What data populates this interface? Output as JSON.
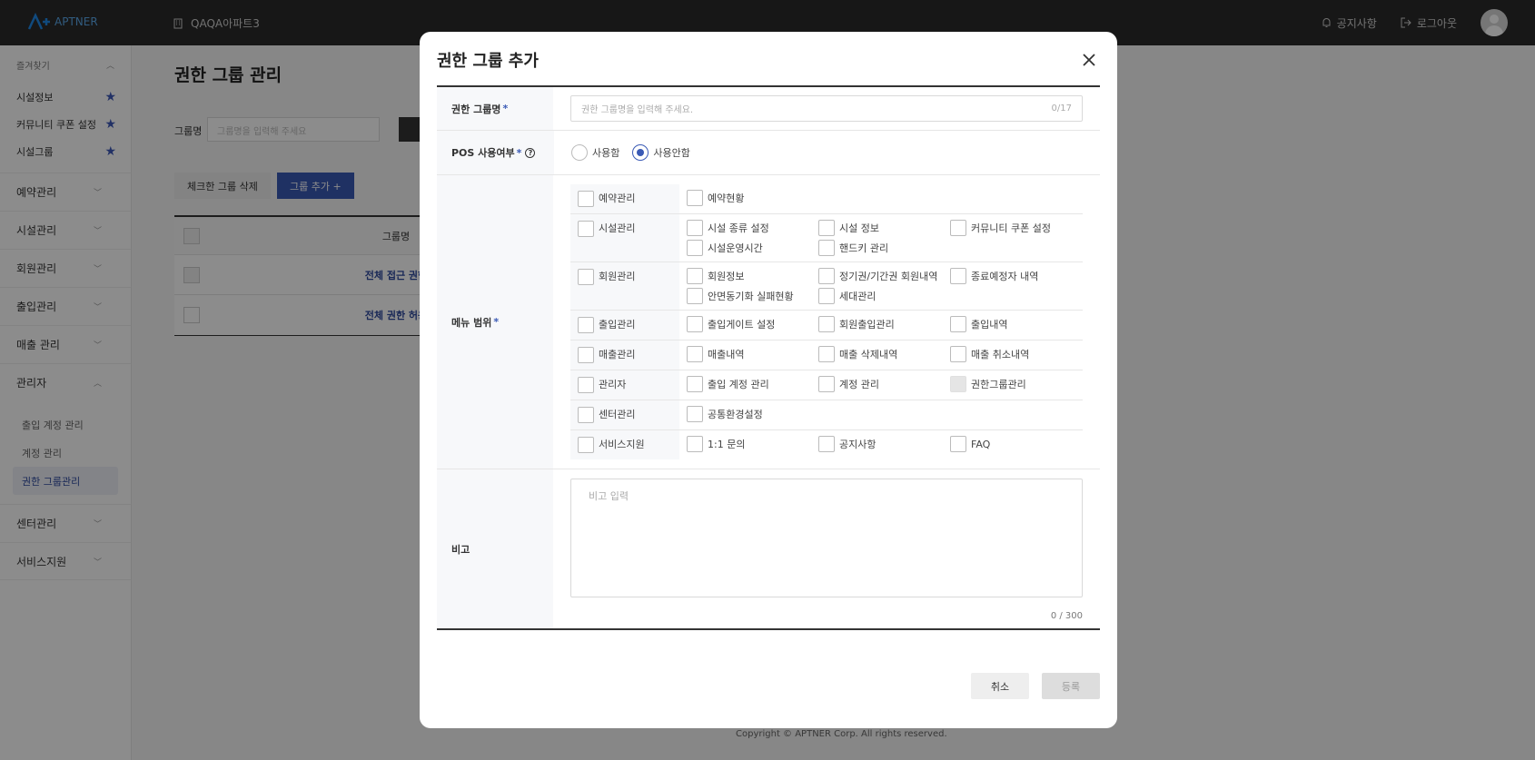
{
  "header": {
    "logo_text": "APTNER",
    "apartment": "QAQA아파트3",
    "notice": "공지사항",
    "logout": "로그아웃"
  },
  "sidebar": {
    "favorites_title": "즐겨찾기",
    "favorites": [
      "시설정보",
      "커뮤니티 쿠폰 설정",
      "시설그룹"
    ],
    "sections": [
      "예약관리",
      "시설관리",
      "회원관리",
      "출입관리",
      "매출 관리",
      "관리자"
    ],
    "admin_items": [
      "출입 계정 관리",
      "계정 관리",
      "권한 그룹관리"
    ],
    "bottom_sections": [
      "센터관리",
      "서비스지원"
    ]
  },
  "page": {
    "title": "권한 그룹 관리",
    "filter_label": "그룹명",
    "filter_placeholder": "그룹명을 입력해 주세요",
    "delete_btn": "체크한 그룹 삭제",
    "add_btn": "그룹 추가  +",
    "table_header": "그룹명",
    "rows": [
      "전체 접근 권한",
      "전체 권한 허용"
    ],
    "footer": "Copyright © APTNER Corp. All rights reserved."
  },
  "modal": {
    "title": "권한 그룹 추가",
    "name_label": "권한 그룹명",
    "name_placeholder": "권한 그룹명을 입력해 주세요.",
    "name_count": "0/17",
    "pos_label": "POS 사용여부",
    "pos_help": "?",
    "pos_options": [
      "사용함",
      "사용안함"
    ],
    "pos_selected": "사용안함",
    "menu_label": "메뉴 범위",
    "menu": [
      {
        "category": "예약관리",
        "items": [
          "예약현황"
        ]
      },
      {
        "category": "시설관리",
        "items": [
          "시설 종류 설정",
          "시설 정보",
          "커뮤니티 쿠폰 설정",
          "시설운영시간",
          "핸드키 관리"
        ]
      },
      {
        "category": "회원관리",
        "items": [
          "회원정보",
          "정기권/기간권 회원내역",
          "종료예정자 내역",
          "안면동기화 실패현황",
          "세대관리"
        ]
      },
      {
        "category": "출입관리",
        "items": [
          "출입게이트 설정",
          "회원출입관리",
          "출입내역"
        ]
      },
      {
        "category": "매출관리",
        "items": [
          "매출내역",
          "매출 삭제내역",
          "매출 취소내역"
        ]
      },
      {
        "category": "관리자",
        "items": [
          "출입 계정 관리",
          "계정 관리",
          "권한그룹관리"
        ]
      },
      {
        "category": "센터관리",
        "items": [
          "공통환경설정"
        ]
      },
      {
        "category": "서비스지원",
        "items": [
          "1:1 문의",
          "공지사항",
          "FAQ"
        ]
      }
    ],
    "note_label": "비고",
    "note_placeholder": "비고 입력",
    "note_count": "0 / 300",
    "cancel": "취소",
    "submit": "등록"
  }
}
